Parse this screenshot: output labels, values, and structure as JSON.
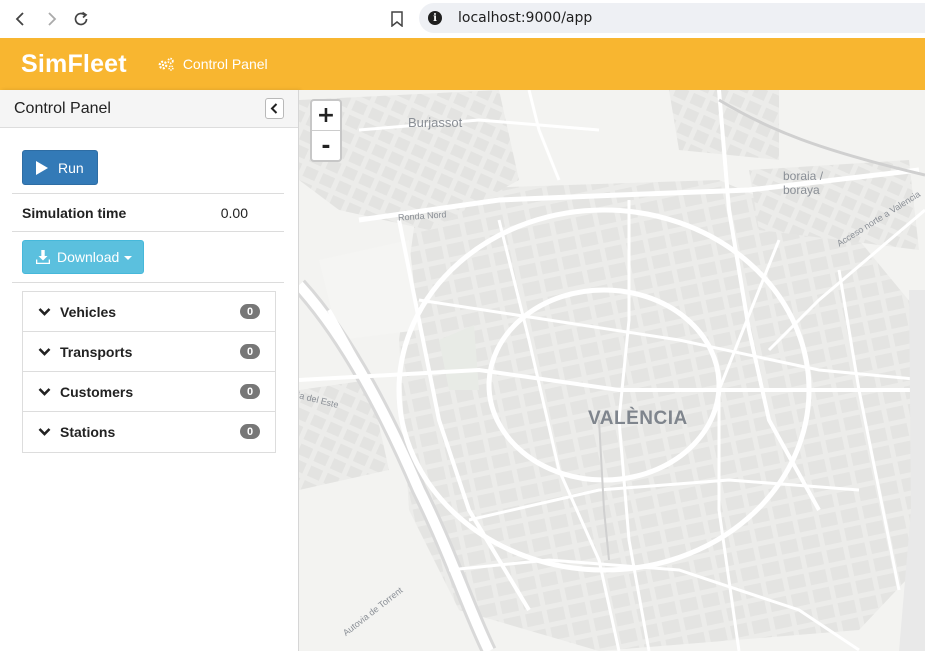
{
  "browser": {
    "url": "localhost:9000/app",
    "back_icon": "chevron-left-icon",
    "forward_icon": "chevron-right-icon",
    "reload_icon": "reload-icon",
    "bookmark_icon": "bookmark-icon",
    "info_icon": "info-icon"
  },
  "header": {
    "brand": "SimFleet",
    "control_panel_link": "Control Panel",
    "accent_color": "#f8b630"
  },
  "sidebar": {
    "title": "Control Panel",
    "run_label": "Run",
    "simulation_time_label": "Simulation time",
    "simulation_time_value": "0.00",
    "download_label": "Download",
    "sections": [
      {
        "label": "Vehicles",
        "count": "0"
      },
      {
        "label": "Transports",
        "count": "0"
      },
      {
        "label": "Customers",
        "count": "0"
      },
      {
        "label": "Stations",
        "count": "0"
      }
    ]
  },
  "map": {
    "zoom_in": "+",
    "zoom_out": "-",
    "labels": {
      "city": "VALÈNCIA",
      "burjassot": "Burjassot",
      "ronda_nord": "Ronda Nord",
      "alboraya_1": "boraia /",
      "alboraya_2": "boraya",
      "acceso": "Acceso norte a Valencia",
      "del_este": "ia del Este",
      "torrent": "Autovia de Torrent"
    }
  }
}
